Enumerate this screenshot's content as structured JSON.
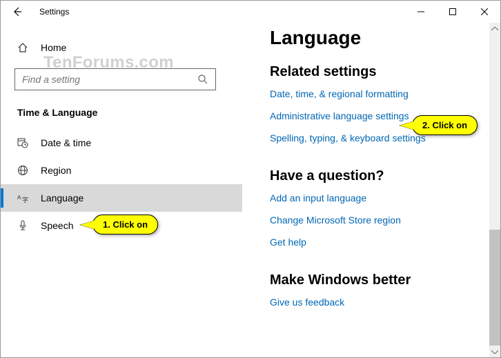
{
  "titlebar": {
    "title": "Settings"
  },
  "sidebar": {
    "home_label": "Home",
    "search_placeholder": "Find a setting",
    "category": "Time & Language",
    "items": [
      {
        "label": "Date & time"
      },
      {
        "label": "Region"
      },
      {
        "label": "Language"
      },
      {
        "label": "Speech"
      }
    ]
  },
  "main": {
    "title": "Language",
    "related_header": "Related settings",
    "related_links": [
      "Date, time, & regional formatting",
      "Administrative language settings",
      "Spelling, typing, & keyboard settings"
    ],
    "question_header": "Have a question?",
    "question_links": [
      "Add an input language",
      "Change Microsoft Store region",
      "Get help"
    ],
    "better_header": "Make Windows better",
    "better_links": [
      "Give us feedback"
    ]
  },
  "callouts": {
    "c1": "1. Click on",
    "c2": "2. Click on"
  },
  "watermark": "TenForums.com"
}
